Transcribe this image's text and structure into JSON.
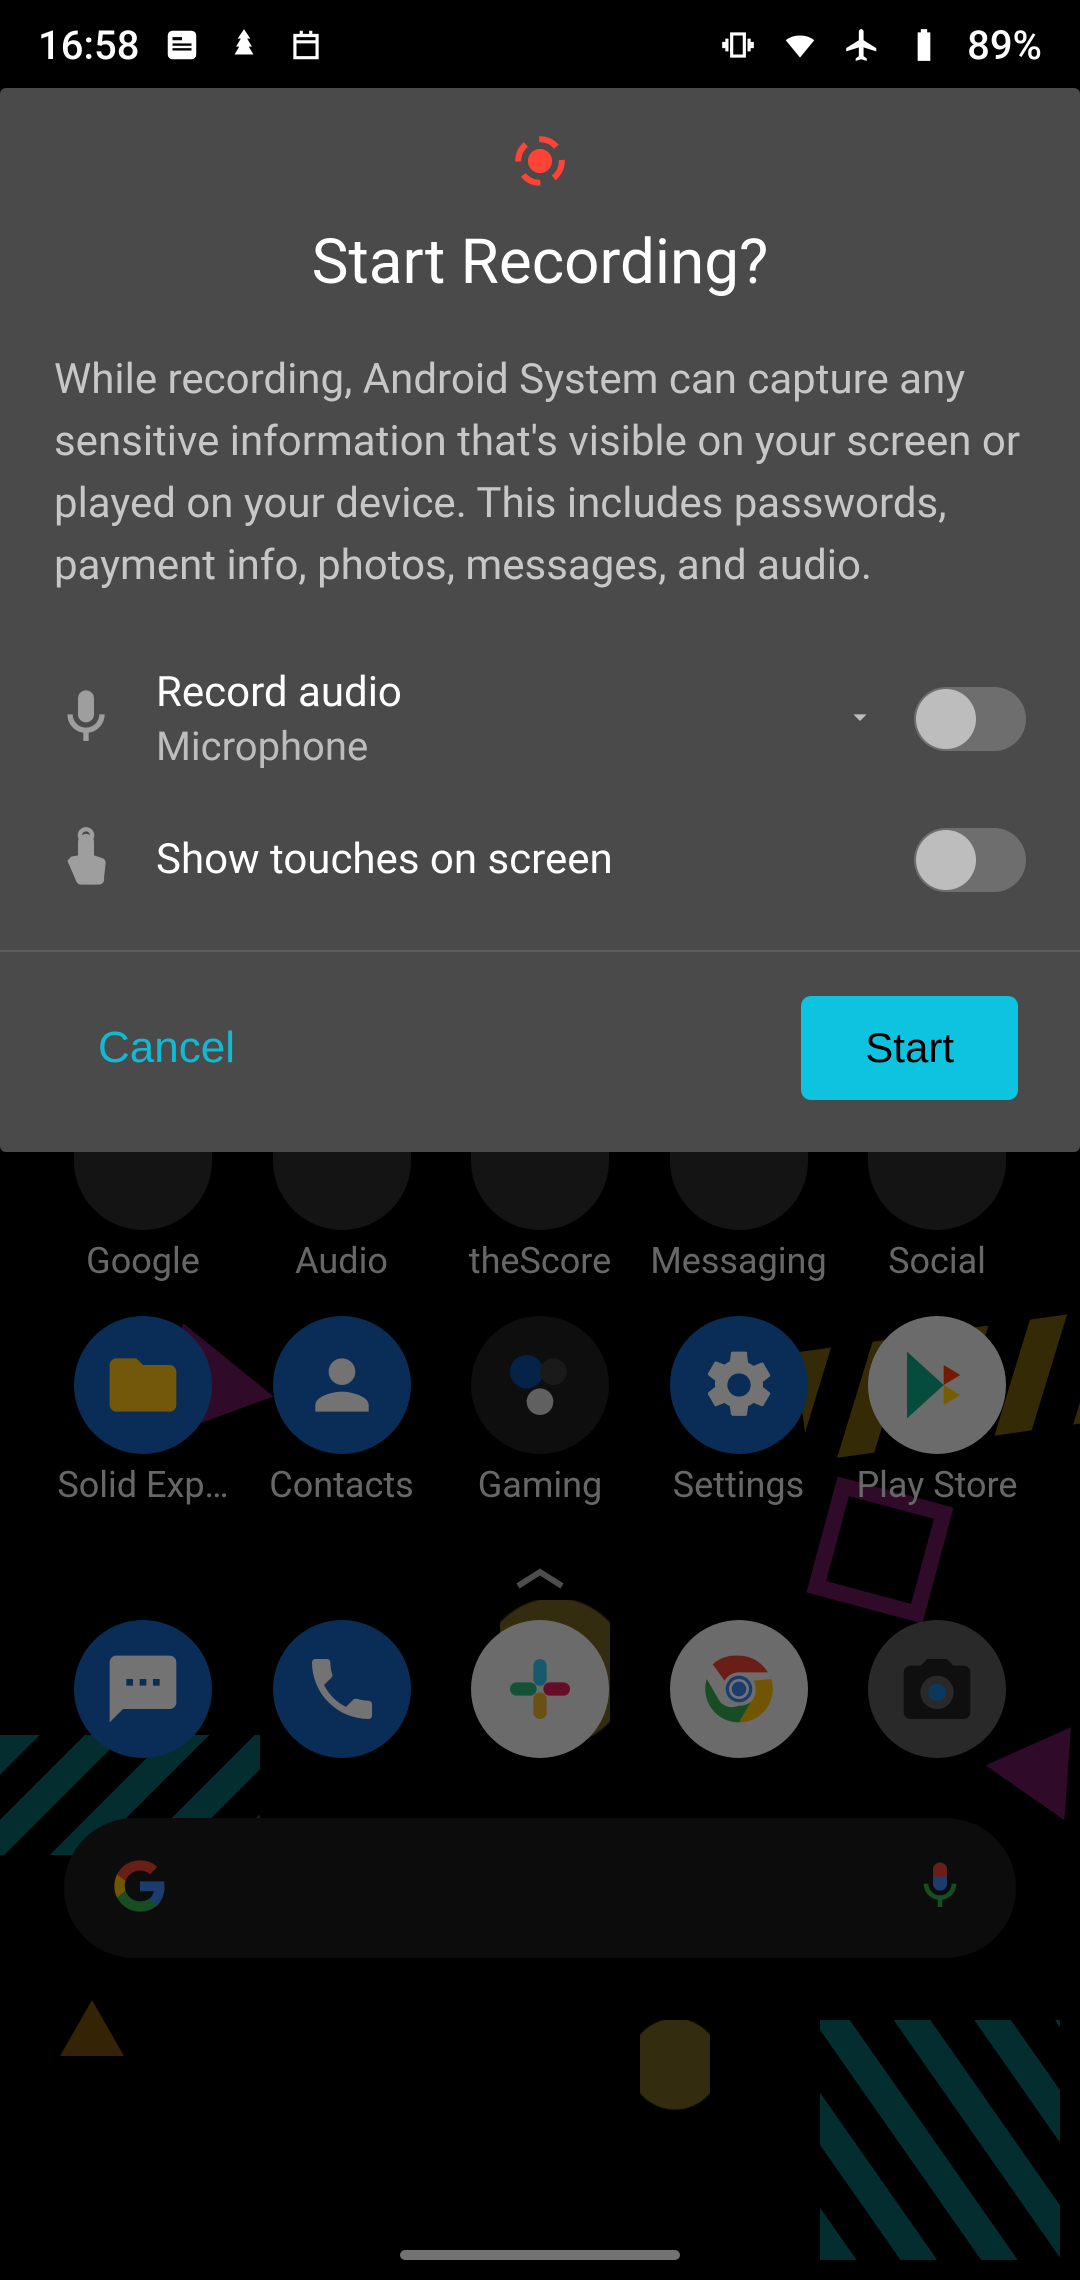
{
  "status_bar": {
    "time": "16:58",
    "battery": "89%"
  },
  "dialog": {
    "title": "Start Recording?",
    "body": "While recording, Android System can capture any sensitive information that's visible on your screen or played on your device. This includes passwords, payment info, photos, messages, and audio.",
    "record_audio_title": "Record audio",
    "record_audio_subtitle": "Microphone",
    "show_touches_title": "Show touches on screen",
    "cancel_label": "Cancel",
    "start_label": "Start"
  },
  "home": {
    "row0": [
      "Google",
      "Audio",
      "theScore",
      "Messaging",
      "Social"
    ],
    "row1": [
      "Solid Exp…",
      "Contacts",
      "Gaming",
      "Settings",
      "Play Store"
    ]
  }
}
